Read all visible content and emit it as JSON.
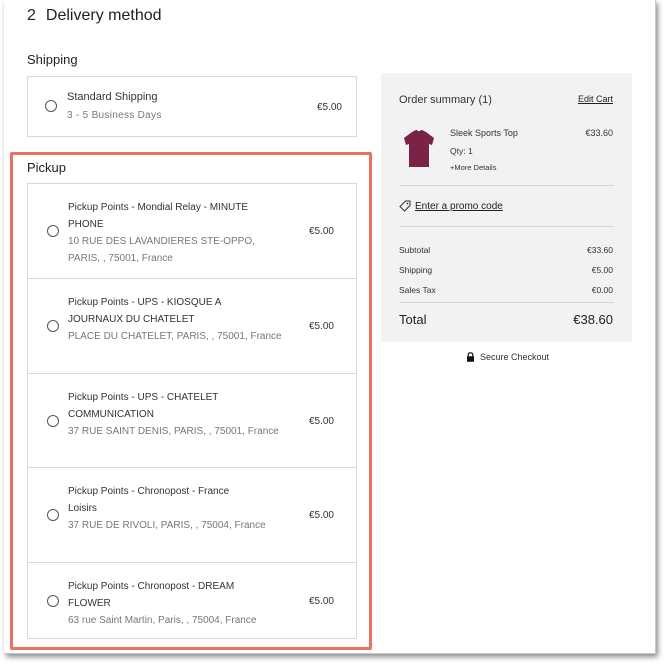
{
  "delivery": {
    "step_number": "2",
    "title": "Delivery method"
  },
  "shipping": {
    "heading": "Shipping",
    "option": {
      "name": "Standard Shipping",
      "sub": "3 - 5 Business Days",
      "price": "€5.00"
    }
  },
  "pickup": {
    "heading": "Pickup",
    "items": [
      {
        "name": "Pickup Points - Mondial Relay - MINUTE PHONE",
        "address": "10 RUE DES LAVANDIERES STE-OPPO, PARIS, , 75001, France",
        "price": "€5.00"
      },
      {
        "name": "Pickup Points - UPS - KIOSQUE A JOURNAUX DU CHATELET",
        "address": "PLACE DU CHATELET, PARIS, , 75001, France",
        "price": "€5.00"
      },
      {
        "name": "Pickup Points - UPS - CHATELET COMMUNICATION",
        "address": "37 RUE SAINT DENIS, PARIS, , 75001, France",
        "price": "€5.00"
      },
      {
        "name": "Pickup Points - Chronopost - France Loisirs",
        "address": "37 RUE DE RIVOLI, PARIS, , 75004, France",
        "price": "€5.00"
      },
      {
        "name": "Pickup Points - Chronopost - DREAM FLOWER",
        "address": "63 rue Saint Martin, Paris, , 75004, France",
        "price": "€5.00"
      }
    ]
  },
  "summary": {
    "title": "Order summary (1)",
    "edit_cart": "Edit Cart",
    "product": {
      "name": "Sleek Sports Top",
      "price": "€33.60",
      "qty": "Qty: 1",
      "more": "+More Details",
      "image_color": "#7a2347"
    },
    "promo": "Enter a promo code",
    "subtotal_label": "Subtotal",
    "subtotal_value": "€33.60",
    "shipping_label": "Shipping",
    "shipping_value": "€5.00",
    "tax_label": "Sales Tax",
    "tax_value": "€0.00",
    "total_label": "Total",
    "total_value": "€38.60"
  },
  "secure_checkout": "Secure Checkout",
  "colors": {
    "highlight": "#e8735e",
    "summary_bg": "#f2f2f2"
  }
}
